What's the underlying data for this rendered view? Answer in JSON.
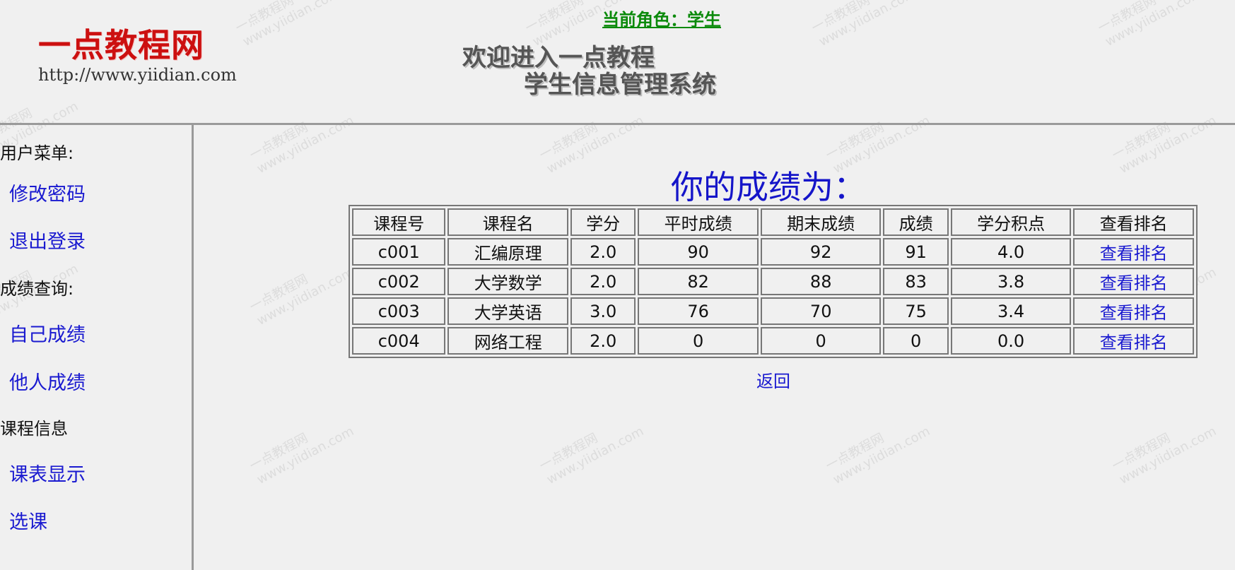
{
  "header": {
    "logo_text": "一点教程网",
    "logo_url": "http://www.yiidian.com",
    "role": "当前角色：学生",
    "welcome_line1": "欢迎进入一点教程",
    "welcome_line2": "学生信息管理系统"
  },
  "sidebar": {
    "sections": [
      {
        "label": "用户菜单:",
        "items": [
          {
            "label": "修改密码"
          },
          {
            "label": "退出登录"
          }
        ]
      },
      {
        "label": "成绩查询:",
        "items": [
          {
            "label": "自己成绩"
          },
          {
            "label": "他人成绩"
          }
        ]
      },
      {
        "label": "课程信息",
        "items": [
          {
            "label": "课表显示"
          },
          {
            "label": "选课"
          }
        ]
      }
    ]
  },
  "main": {
    "title": "你的成绩为：",
    "table": {
      "headers": [
        "课程号",
        "课程名",
        "学分",
        "平时成绩",
        "期末成绩",
        "成绩",
        "学分积点",
        "查看排名"
      ],
      "rows": [
        [
          "c001",
          "汇编原理",
          "2.0",
          "90",
          "92",
          "91",
          "4.0",
          "查看排名"
        ],
        [
          "c002",
          "大学数学",
          "2.0",
          "82",
          "88",
          "83",
          "3.8",
          "查看排名"
        ],
        [
          "c003",
          "大学英语",
          "3.0",
          "76",
          "70",
          "75",
          "3.4",
          "查看排名"
        ],
        [
          "c004",
          "网络工程",
          "2.0",
          "0",
          "0",
          "0",
          "0.0",
          "查看排名"
        ]
      ]
    },
    "back_label": "返回"
  },
  "watermark": {
    "line1": "一点教程网",
    "line2": "www.yiidian.com"
  },
  "colors": {
    "logo": "#cc1010",
    "role": "#0b8a0b",
    "link": "#1a1ad0",
    "title": "#1515c9"
  }
}
